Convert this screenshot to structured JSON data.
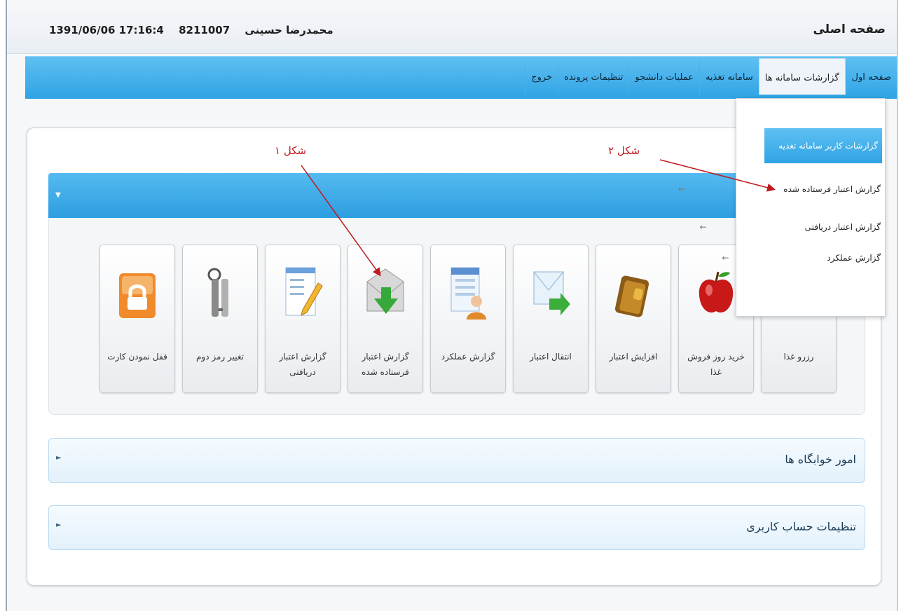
{
  "header": {
    "title": "صفحه اصلی",
    "user_name": "محمدرضا حسینی",
    "user_id": "8211007",
    "datetime": "1391/06/06 17:16:4"
  },
  "nav": {
    "items": [
      {
        "label": "صفحه اول"
      },
      {
        "label": "گزارشات سامانه ها"
      },
      {
        "label": "سامانه تغذیه"
      },
      {
        "label": "عملیات دانشجو"
      },
      {
        "label": "تنظیمات پرونده"
      },
      {
        "label": "خروج"
      }
    ],
    "active_index": 1
  },
  "dropdown": {
    "header": "گزارشات کاربر سامانه تغذیه",
    "items": [
      {
        "label": "گزارش اعتبار فرستاده شده"
      },
      {
        "label": "گزارش اعتبار دریافتی"
      },
      {
        "label": "گزارش عملکرد"
      }
    ]
  },
  "tiles": [
    {
      "label": "رزرو غذا",
      "icon": "plate-icon"
    },
    {
      "label": "خرید روز فروش غذا",
      "icon": "apple-icon"
    },
    {
      "label": "افزایش اعتبار",
      "icon": "wallet-icon"
    },
    {
      "label": "انتقال اعتبار",
      "icon": "mail-transfer-icon"
    },
    {
      "label": "گزارش عملکرد",
      "icon": "report-person-icon"
    },
    {
      "label": "گزارش اعتبار فرستاده شده",
      "icon": "envelope-down-icon"
    },
    {
      "label": "گزارش اعتبار دریافتی",
      "icon": "notepad-pencil-icon"
    },
    {
      "label": "تغییر رمز دوم",
      "icon": "keys-icon"
    },
    {
      "label": "قفل نمودن کارت",
      "icon": "lock-icon"
    }
  ],
  "sections": {
    "dormitory": "امور خوابگاه ها",
    "account": "تنظیمات حساب کاربری"
  },
  "annotations": {
    "figure1": "شکل ۱",
    "figure2": "شکل ۲"
  },
  "colors": {
    "nav_blue": "#2fa3e4",
    "annotation_red": "#c0191e"
  }
}
